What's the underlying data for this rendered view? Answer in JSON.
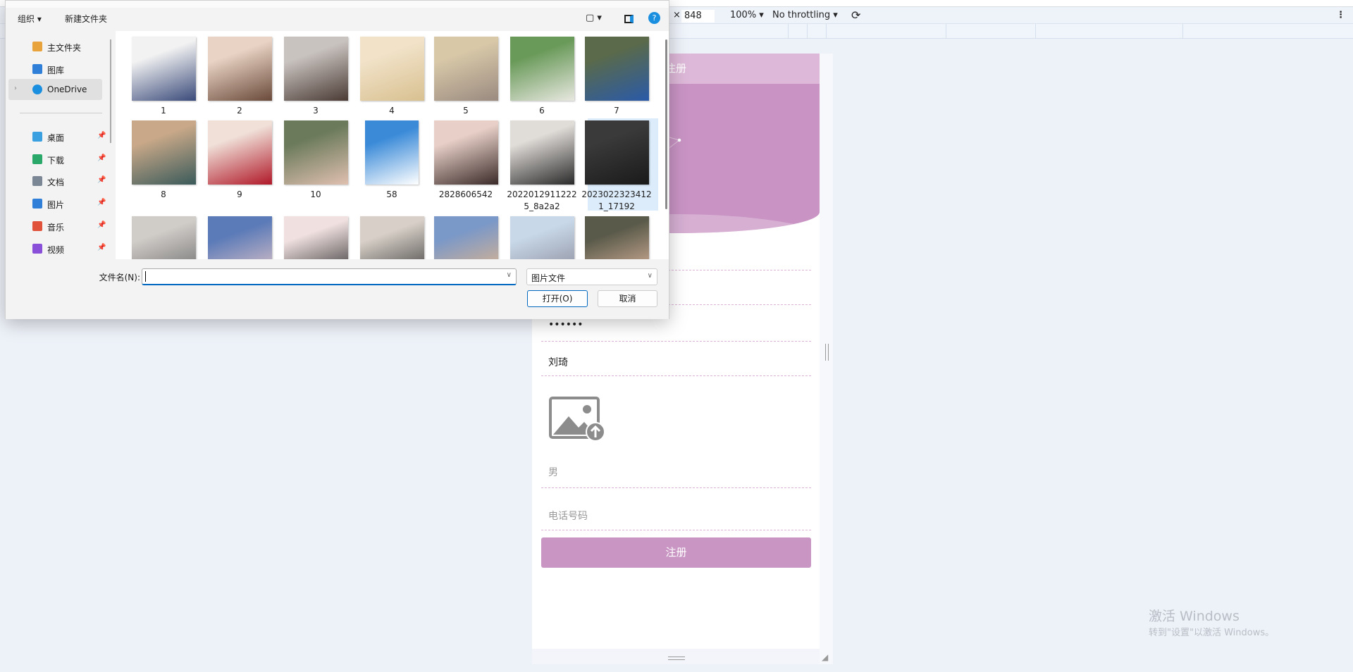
{
  "devtools": {
    "height_value": "848",
    "zoom": "100% ▾",
    "throttling": "No throttling ▾",
    "times": "×"
  },
  "page": {
    "header_title": "注册",
    "password_mask": "••••••",
    "name_value": "刘琦",
    "gender_value": "男",
    "phone_placeholder": "电话号码",
    "register_button": "注册",
    "accent": "#c996c4"
  },
  "watermark": {
    "line1": "激活 Windows",
    "line2": "转到\"设置\"以激活 Windows。"
  },
  "dialog": {
    "toolbar": {
      "organize": "组织 ▾",
      "new_folder": "新建文件夹"
    },
    "sidebar": [
      {
        "label": "主文件夹",
        "icon": "home-icon",
        "color": "#e8a33d"
      },
      {
        "label": "图库",
        "icon": "gallery-icon",
        "color": "#2f7fd8"
      },
      {
        "label": "OneDrive",
        "icon": "cloud-icon",
        "color": "#1a8fe0",
        "selected": true
      },
      {
        "label": "桌面",
        "icon": "desktop-icon",
        "color": "#3aa0e0",
        "pinned": true
      },
      {
        "label": "下载",
        "icon": "download-icon",
        "color": "#2aa86a",
        "pinned": true
      },
      {
        "label": "文档",
        "icon": "document-icon",
        "color": "#7b8794",
        "pinned": true
      },
      {
        "label": "图片",
        "icon": "pictures-icon",
        "color": "#2f7fd8",
        "pinned": true
      },
      {
        "label": "音乐",
        "icon": "music-icon",
        "color": "#e0533a",
        "pinned": true
      },
      {
        "label": "视频",
        "icon": "video-icon",
        "color": "#8a4fd8",
        "pinned": true
      }
    ],
    "files": [
      {
        "name": "1"
      },
      {
        "name": "2"
      },
      {
        "name": "3"
      },
      {
        "name": "4"
      },
      {
        "name": "5"
      },
      {
        "name": "6"
      },
      {
        "name": "7"
      },
      {
        "name": "8"
      },
      {
        "name": "9"
      },
      {
        "name": "10"
      },
      {
        "name": "58"
      },
      {
        "name": "2828606542"
      },
      {
        "name": "20220129112225_8a2a2"
      },
      {
        "name": "20230223234121_17192",
        "selected": true
      },
      {
        "name": ""
      },
      {
        "name": ""
      },
      {
        "name": ""
      },
      {
        "name": ""
      },
      {
        "name": ""
      },
      {
        "name": ""
      },
      {
        "name": ""
      }
    ],
    "filename_label": "文件名(N):",
    "filename_value": "",
    "filetype": "图片文件",
    "open_button": "打开(O)",
    "cancel_button": "取消"
  }
}
